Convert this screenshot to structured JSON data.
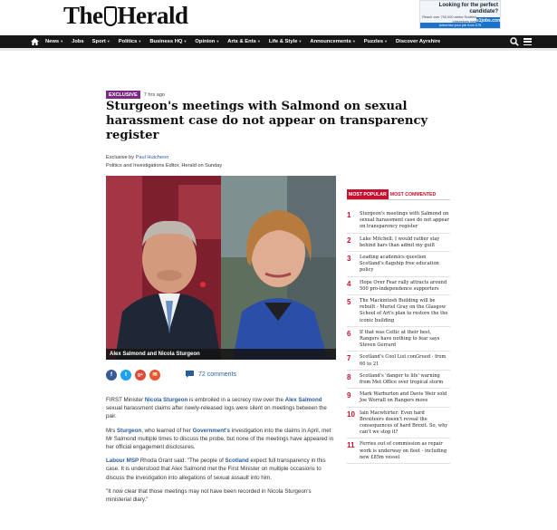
{
  "header": {
    "logo_left": "The",
    "logo_right": "Herald",
    "ad": {
      "title": "Looking for the perfect candidate?",
      "sub": "Reach over 700,000 active Scottish jobseekers now",
      "brand": "s1jobs.com",
      "cta": "Advertise your job from £75"
    }
  },
  "nav": {
    "items": [
      {
        "label": "News",
        "caret": true
      },
      {
        "label": "Jobs",
        "caret": false
      },
      {
        "label": "Sport",
        "caret": true
      },
      {
        "label": "Politics",
        "caret": true
      },
      {
        "label": "Business HQ",
        "caret": true
      },
      {
        "label": "Opinion",
        "caret": true
      },
      {
        "label": "Arts & Ents",
        "caret": true
      },
      {
        "label": "Life & Style",
        "caret": true
      },
      {
        "label": "Announcements",
        "caret": true
      },
      {
        "label": "Puzzles",
        "caret": true
      },
      {
        "label": "Discover Ayrshire",
        "caret": false
      }
    ]
  },
  "article": {
    "badge": "EXCLUSIVE",
    "time": "7 hrs ago",
    "headline": "Sturgeon's meetings with Salmond on sexual harassment case do not appear on transparency register",
    "byline_prefix": "Exclusive by ",
    "author": "Paul Hutcheon",
    "role": "Politics and Investigations Editor, Herald on Sunday",
    "image_caption": "Alex Salmond and Nicola Sturgeon",
    "comments": "72 comments",
    "share": {
      "facebook": "f",
      "twitter": "t",
      "google": "g+",
      "email": "✉"
    },
    "paragraphs": [
      [
        {
          "t": "FIRST Minister ",
          "b": false
        },
        {
          "t": "Nicola Sturgeon",
          "b": true
        },
        {
          "t": " is embroiled in a secrecy row over the ",
          "b": false
        },
        {
          "t": "Alex Salmond",
          "b": true
        },
        {
          "t": " sexual harassment claims after newly-released logs were silent on meetings between the pair.",
          "b": false
        }
      ],
      [
        {
          "t": "Mrs ",
          "b": false
        },
        {
          "t": "Sturgeon",
          "b": true
        },
        {
          "t": ", who learned of her ",
          "b": false
        },
        {
          "t": "Government's",
          "b": true
        },
        {
          "t": " investigation into the claims in April, met Mr Salmond multiple times to discuss the probe, but none of the meetings have appeared in her official engagement disclosures.",
          "b": false
        }
      ],
      [
        {
          "t": "Labour MSP",
          "b": true
        },
        {
          "t": " Rhoda Grant said: \"The people of ",
          "b": false
        },
        {
          "t": "Scotland",
          "b": true
        },
        {
          "t": " expect full transparency in this case. It is understood that Alex Salmond met the First Minister on multiple occasions to discuss the investigation into allegations of sexual assault into him.",
          "b": false
        }
      ],
      [
        {
          "t": "\"It now clear that those meetings may not have been recorded in Nicola Sturgeon's ministerial diary.\"",
          "b": false
        }
      ]
    ]
  },
  "sidebar": {
    "tab_popular": "MOST POPULAR",
    "tab_commented": "MOST COMMENTED",
    "items": [
      {
        "n": "1",
        "text": "Sturgeon's meetings with Salmond on sexual harassment case do not appear on transparency register"
      },
      {
        "n": "2",
        "text": "Luke Mitchell: I would rather stay behind bars than admit my guilt"
      },
      {
        "n": "3",
        "text": "Leading academics question Scotland's flagship free education policy"
      },
      {
        "n": "4",
        "text": "Hope Over Fear rally attracts around 500 pro-independence supporters"
      },
      {
        "n": "5",
        "text": "The Mackintosh Building will be rebuilt - Muriel Gray on the Glasgow School of Art's plan to restore the the iconic building"
      },
      {
        "n": "6",
        "text": "If that was Celtic at their best, Rangers have nothing to fear says Steven Gerrard"
      },
      {
        "n": "7",
        "text": "Scotland's Cool List conGrued - from 60 to 21"
      },
      {
        "n": "8",
        "text": "Scotland's 'danger to life' warning from Met Office over tropical storm"
      },
      {
        "n": "9",
        "text": "Mark Warburton and Davie Weir sold Joe Worrall on Rangers move"
      },
      {
        "n": "10",
        "text": "Iain Macwhirter: Even hard Brexiteers doesn't reveal the consequences of hard Brexit. So, why can't we stop it?"
      },
      {
        "n": "11",
        "text": "Ferries out of commission as repair work is underway on fleet - including new £85m vessel"
      }
    ]
  },
  "colors": {
    "accent": "#c8102e",
    "exclusive": "#7b2a82",
    "link": "#2a5d9f",
    "nav": "#161616"
  }
}
